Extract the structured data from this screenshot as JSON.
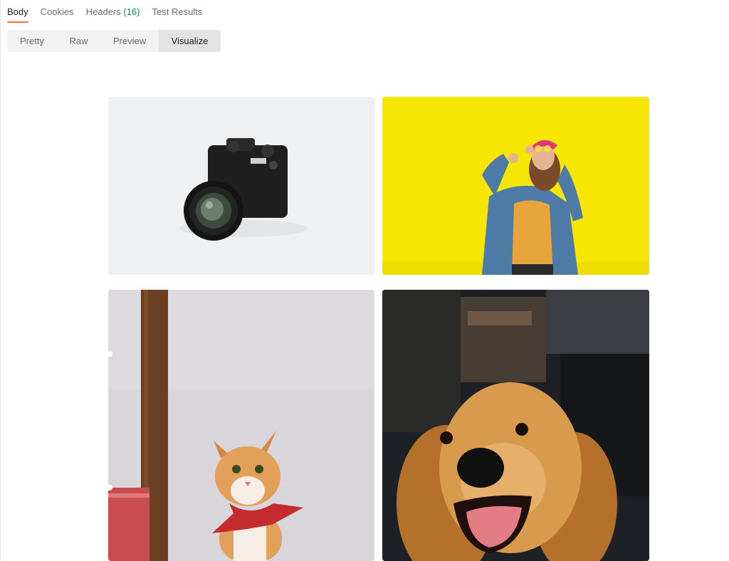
{
  "response_tabs": [
    {
      "label": "Body",
      "active": true
    },
    {
      "label": "Cookies",
      "active": false
    },
    {
      "label": "Headers",
      "count": "(16)",
      "active": false
    },
    {
      "label": "Test Results",
      "active": false
    }
  ],
  "view_modes": [
    {
      "label": "Pretty",
      "active": false
    },
    {
      "label": "Raw",
      "active": false
    },
    {
      "label": "Preview",
      "active": false
    },
    {
      "label": "Visualize",
      "active": true
    }
  ],
  "gallery": {
    "images": [
      {
        "subject": "camera-photo"
      },
      {
        "subject": "woman-yellow-wall-photo"
      },
      {
        "subject": "kitten-photo"
      },
      {
        "subject": "golden-retriever-photo"
      }
    ]
  },
  "colors": {
    "accent": "#ff6c37",
    "count": "#0e8a3c",
    "active_segment": "#e3e3e3",
    "segment_bar": "#f2f2f2"
  }
}
